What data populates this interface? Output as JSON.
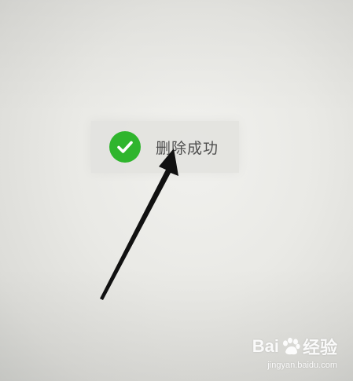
{
  "toast": {
    "message": "删除成功",
    "icon": "check-circle-icon",
    "icon_color": "#2fb52d"
  },
  "watermark": {
    "brand_left": "Bai",
    "brand_right": "经验",
    "url": "jingyan.baidu.com"
  }
}
